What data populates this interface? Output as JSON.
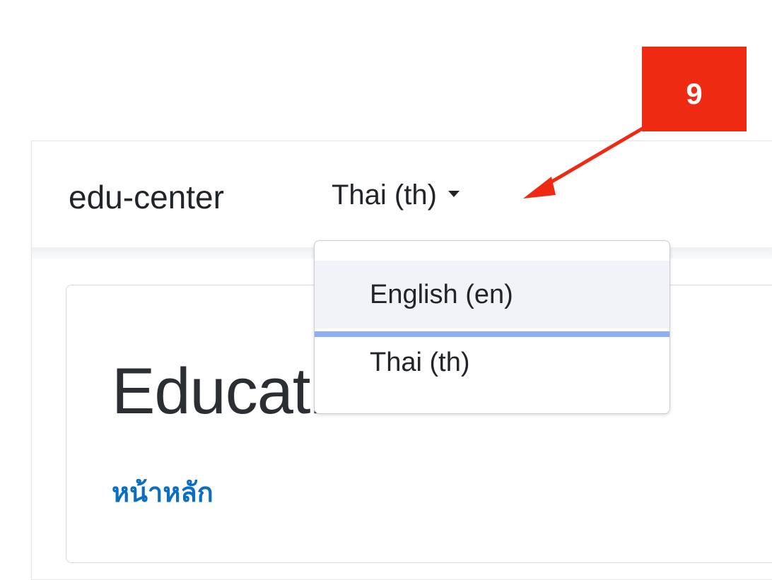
{
  "navbar": {
    "brand": "edu-center",
    "language_toggle": "Thai (th)"
  },
  "page": {
    "title": "Education Center",
    "home_link": "หน้าหลัก"
  },
  "language_dropdown": {
    "items": [
      {
        "label": "English (en)",
        "state": "hovered"
      },
      {
        "label": "Thai (th)",
        "state": "focused"
      }
    ]
  },
  "annotation": {
    "number": "9",
    "color": "#ee2a13"
  },
  "colors": {
    "link": "#0b6ec3",
    "focus_ring": "#8db0f5"
  }
}
